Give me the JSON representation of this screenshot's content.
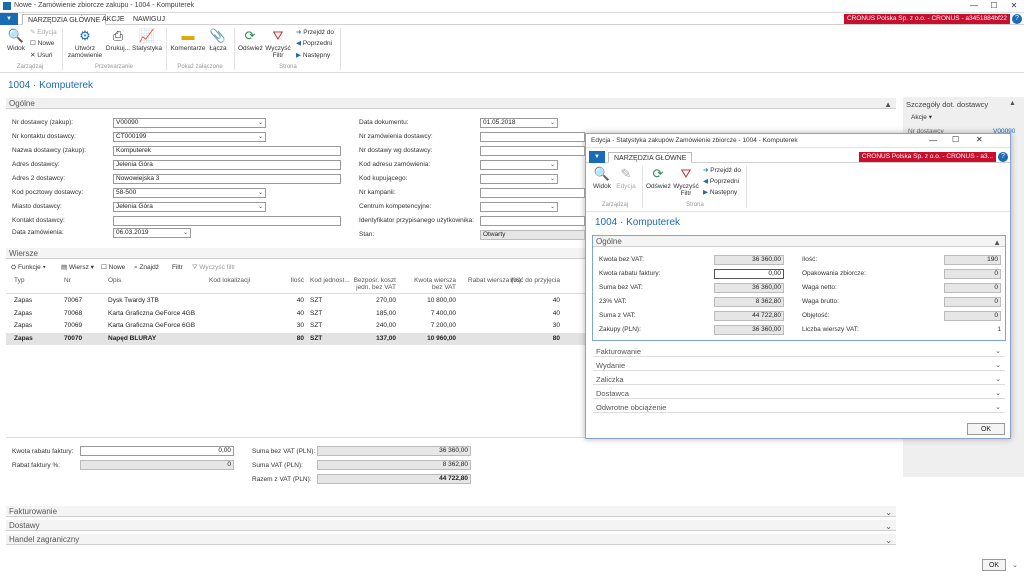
{
  "window": {
    "title": "Nowe - Zamówienie zbiorcze zakupu - 1004 - Komputerek",
    "min": "—",
    "max": "☐",
    "close": "✕"
  },
  "tabs": [
    "NARZĘDZIA GŁÓWNE",
    "AKCJE",
    "NAWIGUJ"
  ],
  "company": "CRONUS Polska Sp. z o.o. - CRONUS - a3451884bf22",
  "ribbon": {
    "widok": "Widok",
    "edycja": "Edycja",
    "nowe": "Nowe",
    "usun": "Usuń",
    "grp_zarzadzaj": "Zarządzaj",
    "utworz": "Utwórz zamówienie",
    "drukuj": "Drukuj...",
    "statystyka": "Statystyka",
    "grp_przetwarzanie": "Przetwarzanie",
    "komentarze": "Komentarze",
    "lacza": "Łącza",
    "grp_zalacz": "Pokaż załączone",
    "odswiez": "Odśwież",
    "wyczysc": "Wyczyść Filtr",
    "przejdz": "Przejdź do",
    "poprzedni": "Poprzedni",
    "nastepny": "Następny",
    "grp_strona": "Strona"
  },
  "page_title": "1004 · Komputerek",
  "ogolne_title": "Ogólne",
  "left_fields": [
    {
      "label": "Nr dostawcy (zakup):",
      "value": "V00090",
      "dd": true
    },
    {
      "label": "Nr kontaktu dostawcy:",
      "value": "CT000199",
      "dd": true
    },
    {
      "label": "Nazwa dostawcy (zakup):",
      "value": "Komputerek",
      "dd": false
    },
    {
      "label": "Adres dostawcy:",
      "value": "Jelenia Góra",
      "dd": false
    },
    {
      "label": "Adres 2 dostawcy:",
      "value": "Nowowiejska 3",
      "dd": false
    },
    {
      "label": "Kod pocztowy dostawcy:",
      "value": "58-500",
      "dd": true
    },
    {
      "label": "Miasto dostawcy:",
      "value": "Jelenia Góra",
      "dd": true
    },
    {
      "label": "Kontakt dostawcy:",
      "value": "",
      "dd": false
    }
  ],
  "data_zamowienia_label": "Data zamówienia:",
  "data_zamowienia": "06.03.2019",
  "right_fields": [
    {
      "label": "Data dokumentu:",
      "value": "01.05.2018",
      "dd": true
    },
    {
      "label": "Nr zamówienia dostawcy:",
      "value": "",
      "dd": false
    },
    {
      "label": "Nr dostawy wg dostawcy:",
      "value": "",
      "dd": false
    },
    {
      "label": "Kod adresu zamówienia:",
      "value": "",
      "dd": true
    },
    {
      "label": "Kod kupującego:",
      "value": "",
      "dd": true
    },
    {
      "label": "Nr kampanii:",
      "value": "",
      "dd": false
    },
    {
      "label": "Centrum kompetencyjne:",
      "value": "",
      "dd": true
    },
    {
      "label": "Identyfikator przypisanego użytkownika:",
      "value": "",
      "dd": false
    },
    {
      "label": "Stan:",
      "value": "Otwarty",
      "dd": false
    }
  ],
  "side": {
    "title": "Szczegóły dot. dostawcy",
    "akcje": "Akcje",
    "nr": "Nr dostawcy",
    "val": "V00090"
  },
  "wiersze": {
    "title": "Wiersze",
    "toolbar": {
      "funkcje": "Funkcje",
      "wiersz": "Wiersz",
      "nowe": "Nowe",
      "znajdz": "Znajdź",
      "filtr": "Filtr",
      "wyczysc": "Wyczyść filtr"
    },
    "headers": [
      "Typ",
      "Nr",
      "Opis",
      "Kod lokalizacji",
      "Ilość",
      "Kod jednost...",
      "Bezpośr. koszt jedn. bez VAT",
      "Kwota wiersza bez VAT",
      "Rabat wiersza (%)",
      "Ilość do przyjęcia"
    ],
    "rows": [
      [
        "Zapas",
        "70067",
        "Dysk Twardy 3TB",
        "",
        "40",
        "SZT",
        "270,00",
        "10 800,00",
        "",
        "40"
      ],
      [
        "Zapas",
        "70068",
        "Karta Graficzna GeForce 4GB",
        "",
        "40",
        "SZT",
        "185,00",
        "7 400,00",
        "",
        "40"
      ],
      [
        "Zapas",
        "70069",
        "Karta Graficzna GeForce 6GB",
        "",
        "30",
        "SZT",
        "240,00",
        "7 200,00",
        "",
        "30"
      ],
      [
        "Zapas",
        "70070",
        "Napęd BLURAY",
        "",
        "80",
        "SZT",
        "137,00",
        "10 960,00",
        "",
        "80"
      ]
    ]
  },
  "totals": {
    "kwota_rabatu_label": "Kwota rabatu faktury:",
    "kwota_rabatu": "0,00",
    "rabat_proc_label": "Rabat faktury %:",
    "rabat_proc": "0",
    "suma_bez_label": "Suma bez VAT (PLN):",
    "suma_bez": "36 360,00",
    "suma_vat_label": "Suma VAT (PLN):",
    "suma_vat": "8 362,80",
    "razem_label": "Razem z VAT (PLN):",
    "razem": "44 722,80"
  },
  "bottom_sections": [
    "Fakturowanie",
    "Dostawy",
    "Handel zagraniczny"
  ],
  "ok": "OK",
  "dialog": {
    "title": "Edycja - Statystyka zakupów Zamówienie zbiorcze - 1004 - Komputerek",
    "tab": "NARZĘDZIA GŁÓWNE",
    "company": "CRONUS Polska Sp. z o.o. - CRONUS - a3...",
    "widok": "Widok",
    "edycja": "Edycja",
    "grp_zarzadzaj": "Zarządzaj",
    "odswiez": "Odśwież",
    "wyczysc": "Wyczyść Filtr",
    "przejdz": "Przejdź do",
    "poprzedni": "Poprzedni",
    "nastepny": "Następny",
    "grp_strona": "Strona",
    "page_title": "1004 · Komputerek",
    "ogolne": "Ogólne",
    "left": [
      {
        "label": "Kwota bez VAT:",
        "value": "36 360,00"
      },
      {
        "label": "Kwota rabatu faktury:",
        "value": "0,00"
      },
      {
        "label": "Suma bez VAT:",
        "value": "36 360,00"
      },
      {
        "label": "23% VAT:",
        "value": "8 362,80"
      },
      {
        "label": "Suma z VAT:",
        "value": "44 722,80"
      },
      {
        "label": "Zakupy (PLN):",
        "value": "36 360,00"
      }
    ],
    "right": [
      {
        "label": "Ilość:",
        "value": "190"
      },
      {
        "label": "Opakowania zbiorcze:",
        "value": "0"
      },
      {
        "label": "Waga netto:",
        "value": "0"
      },
      {
        "label": "Waga brutto:",
        "value": "0"
      },
      {
        "label": "Objętość:",
        "value": "0"
      },
      {
        "label": "Liczba wierszy VAT:",
        "value": "1"
      }
    ],
    "sections": [
      "Fakturowanie",
      "Wydanie",
      "Zaliczka",
      "Dostawca",
      "Odwrotne obciążenie"
    ],
    "ok": "OK"
  }
}
